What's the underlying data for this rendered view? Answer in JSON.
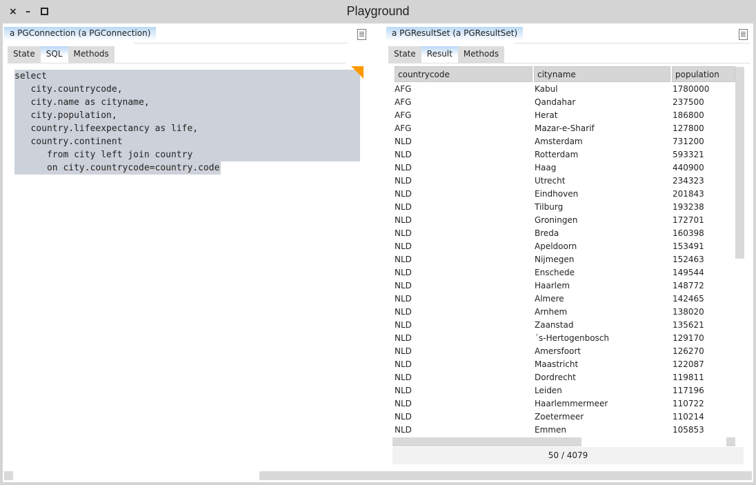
{
  "window": {
    "title": "Playground",
    "close": "×",
    "minimize": "–",
    "maximize": "□"
  },
  "left": {
    "title": "a PGConnection (a PGConnection)",
    "tabs": [
      "State",
      "SQL",
      "Methods"
    ],
    "active_tab": "SQL",
    "code": [
      "select",
      "   city.countrycode,",
      "   city.name as cityname,",
      "   city.population,",
      "   country.lifeexpectancy as life,",
      "   country.continent",
      "      from city left join country",
      "      on city.countrycode=country.code"
    ]
  },
  "right": {
    "title": "a PGResultSet (a PGResultSet)",
    "tabs": [
      "State",
      "Result",
      "Methods"
    ],
    "active_tab": "Result",
    "columns": [
      "countrycode",
      "cityname",
      "population"
    ],
    "rows": [
      [
        "AFG",
        "Kabul",
        "1780000"
      ],
      [
        "AFG",
        "Qandahar",
        "237500"
      ],
      [
        "AFG",
        "Herat",
        "186800"
      ],
      [
        "AFG",
        "Mazar-e-Sharif",
        "127800"
      ],
      [
        "NLD",
        "Amsterdam",
        "731200"
      ],
      [
        "NLD",
        "Rotterdam",
        "593321"
      ],
      [
        "NLD",
        "Haag",
        "440900"
      ],
      [
        "NLD",
        "Utrecht",
        "234323"
      ],
      [
        "NLD",
        "Eindhoven",
        "201843"
      ],
      [
        "NLD",
        "Tilburg",
        "193238"
      ],
      [
        "NLD",
        "Groningen",
        "172701"
      ],
      [
        "NLD",
        "Breda",
        "160398"
      ],
      [
        "NLD",
        "Apeldoorn",
        "153491"
      ],
      [
        "NLD",
        "Nijmegen",
        "152463"
      ],
      [
        "NLD",
        "Enschede",
        "149544"
      ],
      [
        "NLD",
        "Haarlem",
        "148772"
      ],
      [
        "NLD",
        "Almere",
        "142465"
      ],
      [
        "NLD",
        "Arnhem",
        "138020"
      ],
      [
        "NLD",
        "Zaanstad",
        "135621"
      ],
      [
        "NLD",
        "´s-Hertogenbosch",
        "129170"
      ],
      [
        "NLD",
        "Amersfoort",
        "126270"
      ],
      [
        "NLD",
        "Maastricht",
        "122087"
      ],
      [
        "NLD",
        "Dordrecht",
        "119811"
      ],
      [
        "NLD",
        "Leiden",
        "117196"
      ],
      [
        "NLD",
        "Haarlemmermeer",
        "110722"
      ],
      [
        "NLD",
        "Zoetermeer",
        "110214"
      ],
      [
        "NLD",
        "Emmen",
        "105853"
      ]
    ],
    "footer": "50 / 4079"
  },
  "colors": {
    "accent": "#b9d8f5",
    "selection": "#cdd2da",
    "corner": "#ff9900"
  }
}
